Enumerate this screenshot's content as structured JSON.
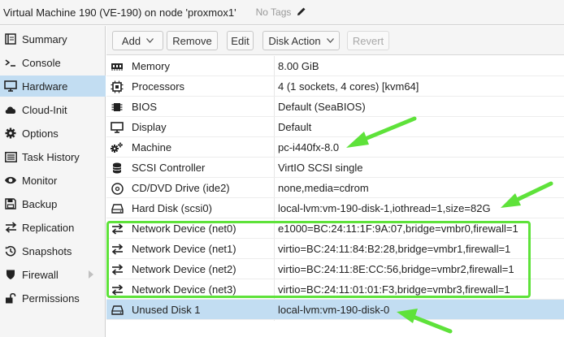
{
  "header": {
    "title": "Virtual Machine 190 (VE-190) on node 'proxmox1'",
    "tags": "No Tags"
  },
  "sidebar": {
    "items": [
      {
        "label": "Summary",
        "icon": "summary-icon",
        "active": false
      },
      {
        "label": "Console",
        "icon": "console-icon",
        "active": false
      },
      {
        "label": "Hardware",
        "icon": "monitor-icon",
        "active": true
      },
      {
        "label": "Cloud-Init",
        "icon": "cloud-icon",
        "active": false
      },
      {
        "label": "Options",
        "icon": "gear-icon",
        "active": false
      },
      {
        "label": "Task History",
        "icon": "task-list-icon",
        "active": false
      },
      {
        "label": "Monitor",
        "icon": "eye-icon",
        "active": false
      },
      {
        "label": "Backup",
        "icon": "floppy-icon",
        "active": false
      },
      {
        "label": "Replication",
        "icon": "replication-icon",
        "active": false
      },
      {
        "label": "Snapshots",
        "icon": "history-icon",
        "active": false
      },
      {
        "label": "Firewall",
        "icon": "shield-icon",
        "active": false,
        "has_submenu": true
      },
      {
        "label": "Permissions",
        "icon": "unlock-icon",
        "active": false
      }
    ]
  },
  "toolbar": {
    "add": "Add",
    "remove": "Remove",
    "edit": "Edit",
    "disk_action": "Disk Action",
    "revert": "Revert"
  },
  "hardware": [
    {
      "name": "Memory",
      "value": "8.00 GiB",
      "icon": "memory-icon"
    },
    {
      "name": "Processors",
      "value": "4 (1 sockets, 4 cores) [kvm64]",
      "icon": "cpu-icon"
    },
    {
      "name": "BIOS",
      "value": "Default (SeaBIOS)",
      "icon": "bios-chip-icon"
    },
    {
      "name": "Display",
      "value": "Default",
      "icon": "display-icon"
    },
    {
      "name": "Machine",
      "value": "pc-i440fx-8.0",
      "icon": "machine-cogs-icon"
    },
    {
      "name": "SCSI Controller",
      "value": "VirtIO SCSI single",
      "icon": "database-icon"
    },
    {
      "name": "CD/DVD Drive (ide2)",
      "value": "none,media=cdrom",
      "icon": "cdrom-icon"
    },
    {
      "name": "Hard Disk (scsi0)",
      "value": "local-lvm:vm-190-disk-1,iothread=1,size=82G",
      "icon": "hard-disk-icon"
    },
    {
      "name": "Network Device (net0)",
      "value": "e1000=BC:24:11:1F:9A:07,bridge=vmbr0,firewall=1",
      "icon": "network-exchange-icon"
    },
    {
      "name": "Network Device (net1)",
      "value": "virtio=BC:24:11:84:B2:28,bridge=vmbr1,firewall=1",
      "icon": "network-exchange-icon"
    },
    {
      "name": "Network Device (net2)",
      "value": "virtio=BC:24:11:8E:CC:56,bridge=vmbr2,firewall=1",
      "icon": "network-exchange-icon"
    },
    {
      "name": "Network Device (net3)",
      "value": "virtio=BC:24:11:01:01:F3,bridge=vmbr3,firewall=1",
      "icon": "network-exchange-icon"
    },
    {
      "name": "Unused Disk 1",
      "value": "local-lvm:vm-190-disk-0",
      "icon": "hard-disk-icon",
      "selected": true
    }
  ],
  "colors": {
    "selection": "#c2ddf2",
    "annotation_green": "#5ee23a"
  }
}
